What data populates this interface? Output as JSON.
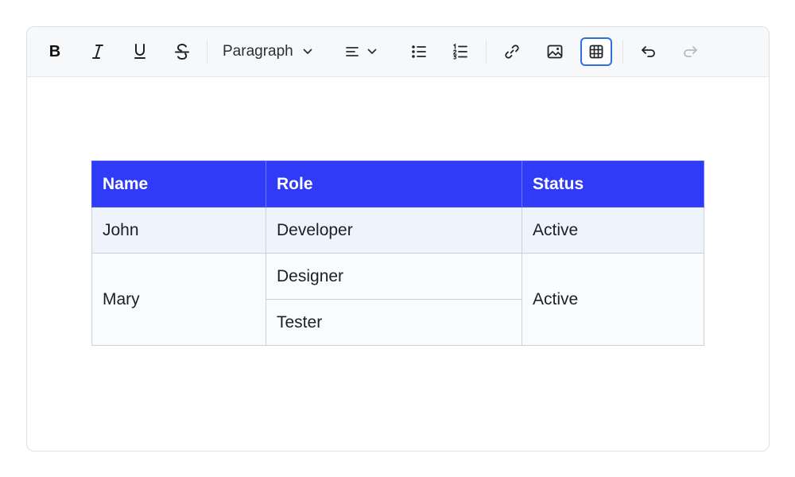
{
  "toolbar": {
    "bold_label": "B",
    "paragraph_label": "Paragraph",
    "buttons": [
      {
        "name": "bold",
        "icon": "bold-icon"
      },
      {
        "name": "italic",
        "icon": "italic-icon"
      },
      {
        "name": "underline",
        "icon": "underline-icon"
      },
      {
        "name": "strikethrough",
        "icon": "strikethrough-icon"
      },
      {
        "name": "paragraph-dropdown",
        "icon": "chevron-down-icon"
      },
      {
        "name": "align-dropdown",
        "icon": "align-left-icon"
      },
      {
        "name": "bullet-list",
        "icon": "bullet-list-icon"
      },
      {
        "name": "numbered-list",
        "icon": "numbered-list-icon"
      },
      {
        "name": "link",
        "icon": "link-icon"
      },
      {
        "name": "image",
        "icon": "image-icon"
      },
      {
        "name": "table",
        "icon": "table-icon",
        "active": true
      },
      {
        "name": "undo",
        "icon": "undo-icon"
      },
      {
        "name": "redo",
        "icon": "redo-icon",
        "disabled": true
      }
    ],
    "active_color": "#2f6fe4"
  },
  "table": {
    "header_color": "#2f3bf7",
    "headers": [
      "Name",
      "Role",
      "Status"
    ],
    "rows": {
      "john": {
        "name": "John",
        "role": "Developer",
        "status": "Active"
      },
      "mary": {
        "name": "Mary",
        "role": "Designer",
        "status": "Active"
      },
      "tester": {
        "role": "Tester"
      }
    }
  }
}
